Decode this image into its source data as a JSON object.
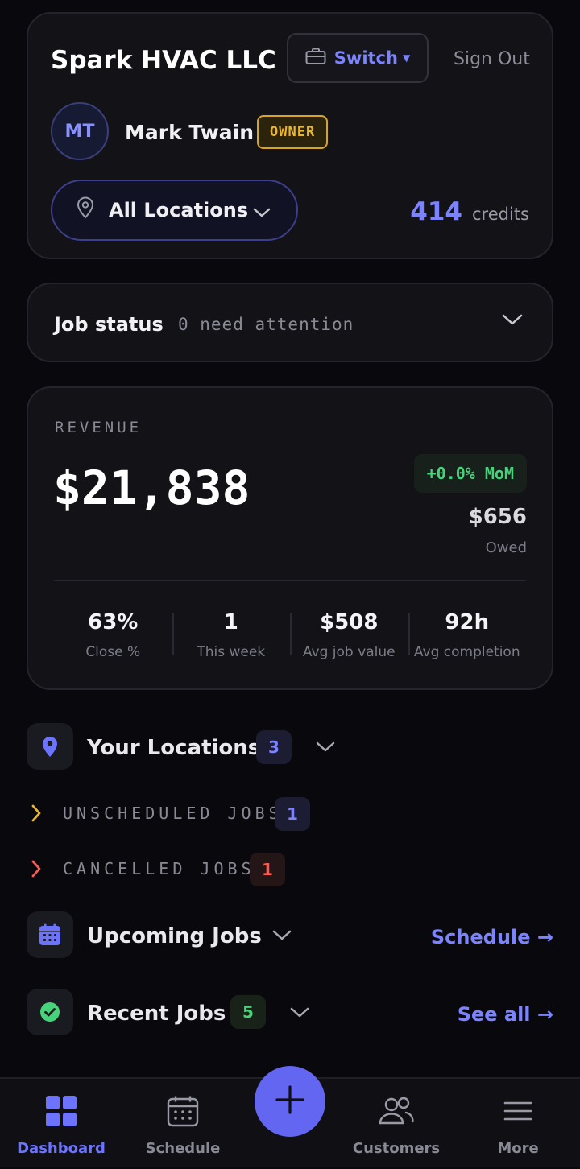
{
  "header": {
    "business_name": "Spark HVAC LLC",
    "switch_label": "Switch",
    "sign_out_label": "Sign Out",
    "user": {
      "initials": "MT",
      "name": "Mark Twain",
      "role": "OWNER"
    },
    "location_select": {
      "value": "All Locations"
    },
    "credits": {
      "value": "414",
      "label": "credits"
    }
  },
  "job_status": {
    "title": "Job status",
    "subtitle": "0 need attention"
  },
  "revenue": {
    "label": "REVENUE",
    "amount": "$21,838",
    "mom": "+0.0% MoM",
    "owed_amount": "$656",
    "owed_label": "Owed",
    "stats": [
      {
        "value": "63%",
        "label": "Close %"
      },
      {
        "value": "1",
        "label": "This week"
      },
      {
        "value": "$508",
        "label": "Avg job value"
      },
      {
        "value": "92h",
        "label": "Avg completion"
      }
    ]
  },
  "locations": {
    "title": "Your Locations",
    "count": "3"
  },
  "job_groups": [
    {
      "label": "UNSCHEDULED JOBS",
      "count": "1"
    },
    {
      "label": "CANCELLED JOBS",
      "count": "1"
    }
  ],
  "upcoming": {
    "title": "Upcoming Jobs",
    "link": "Schedule →"
  },
  "recent": {
    "title": "Recent Jobs",
    "count": "5",
    "link": "See all →"
  },
  "nav": {
    "items": [
      {
        "label": "Dashboard",
        "icon": "dashboard-grid-icon",
        "active": true
      },
      {
        "label": "Schedule",
        "icon": "calendar-icon"
      },
      {
        "label": "Customers",
        "icon": "users-icon"
      },
      {
        "label": "More",
        "icon": "menu-icon"
      }
    ],
    "fab_icon": "plus-icon"
  },
  "colors": {
    "accent": "#6366f1",
    "accent_text": "#7b83ff",
    "owner_badge": "#e8b631",
    "positive": "#46d37a",
    "danger": "#ff5a52",
    "background": "#09090d"
  }
}
